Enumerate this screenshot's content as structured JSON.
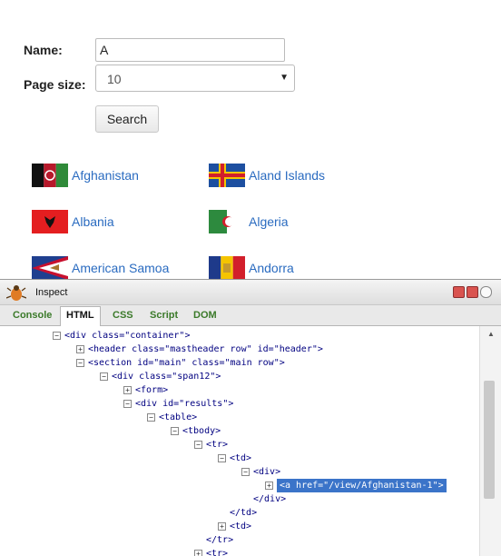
{
  "form": {
    "name_label": "Name:",
    "name_value": "A",
    "pagesize_label": "Page size:",
    "pagesize_value": "10",
    "search_label": "Search"
  },
  "results": [
    {
      "name": "Afghanistan"
    },
    {
      "name": "Aland Islands"
    },
    {
      "name": "Albania"
    },
    {
      "name": "Algeria"
    },
    {
      "name": "American Samoa"
    },
    {
      "name": "Andorra"
    }
  ],
  "inspect": {
    "title": "Inspect",
    "tabs": [
      "Console",
      "HTML",
      "CSS",
      "Script",
      "DOM"
    ],
    "active_tab": "HTML",
    "tree": [
      {
        "depth": 0,
        "toggle": "-",
        "text": "<div class=\"container\">"
      },
      {
        "depth": 1,
        "toggle": "+",
        "text": "<header class=\"mastheader row\" id=\"header\">"
      },
      {
        "depth": 1,
        "toggle": "-",
        "text": "<section id=\"main\" class=\"main row\">"
      },
      {
        "depth": 2,
        "toggle": "-",
        "text": "<div class=\"span12\">"
      },
      {
        "depth": 3,
        "toggle": "+",
        "text": "<form>"
      },
      {
        "depth": 3,
        "toggle": "-",
        "text": "<div id=\"results\">"
      },
      {
        "depth": 4,
        "toggle": "-",
        "text": "<table>"
      },
      {
        "depth": 5,
        "toggle": "-",
        "text": "<tbody>"
      },
      {
        "depth": 6,
        "toggle": "-",
        "text": "<tr>"
      },
      {
        "depth": 7,
        "toggle": "-",
        "text": "<td>"
      },
      {
        "depth": 8,
        "toggle": "-",
        "text": "<div>"
      },
      {
        "depth": 9,
        "toggle": "+",
        "text": "<a href=\"/view/Afghanistan-1\">",
        "selected": true
      },
      {
        "depth": 8,
        "toggle": "",
        "text": "</div>"
      },
      {
        "depth": 7,
        "toggle": "",
        "text": "</td>"
      },
      {
        "depth": 7,
        "toggle": "+",
        "text": "<td>"
      },
      {
        "depth": 6,
        "toggle": "",
        "text": "</tr>"
      },
      {
        "depth": 6,
        "toggle": "+",
        "text": "<tr>"
      }
    ]
  },
  "colors": {
    "link": "#2a6bc0",
    "selection": "#3b74c9",
    "tab_inactive": "#3b7a2a"
  }
}
